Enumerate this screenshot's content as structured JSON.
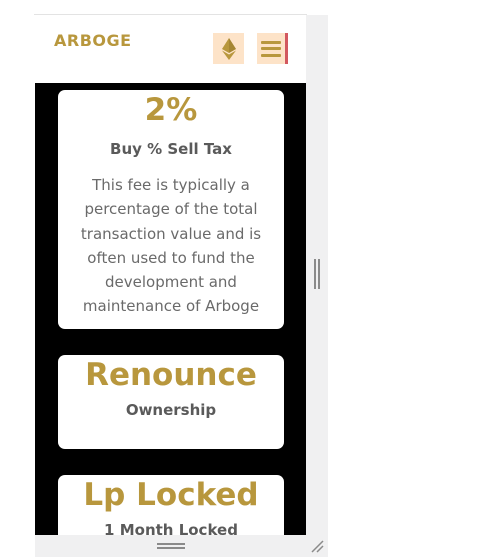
{
  "header": {
    "logo_text": "ARBOGE",
    "eth_icon": "ethereum-icon",
    "menu_icon": "hamburger-menu-icon"
  },
  "cards": [
    {
      "headline": "2%",
      "subtitle": "Buy % Sell Tax",
      "body": "This fee is typically a percentage of the total transaction value and is often used to fund the development and maintenance of Arboge"
    },
    {
      "headline": "Renounce",
      "subtitle": "Ownership"
    },
    {
      "headline": "Lp Locked",
      "subtitle": "1 Month Locked"
    }
  ],
  "colors": {
    "accent_gold": "#b8973d",
    "button_bg": "#fde3c8",
    "page_bg": "#000000",
    "menu_accent": "#d2585f"
  }
}
